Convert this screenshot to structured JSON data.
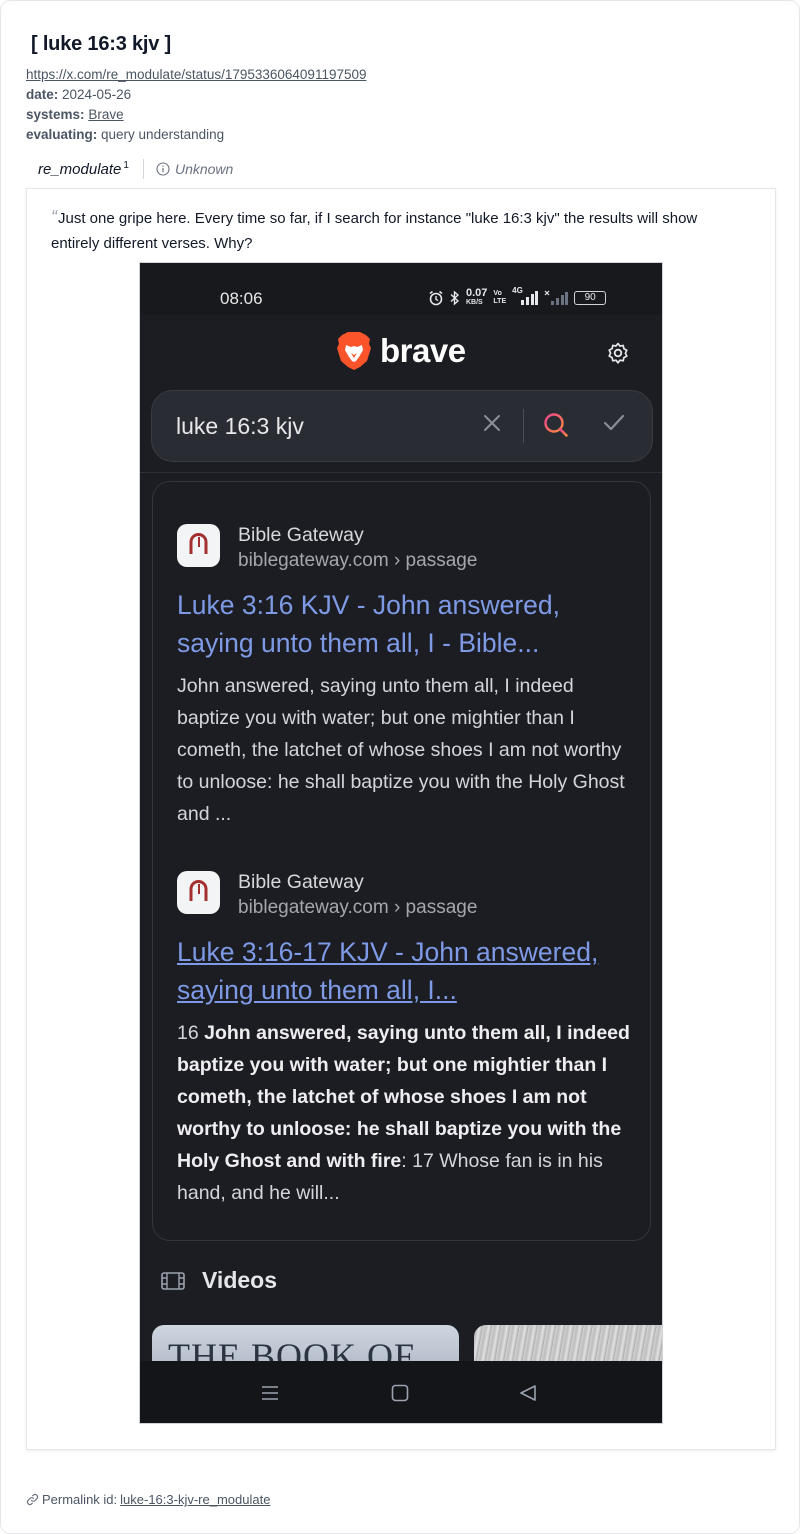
{
  "header": {
    "title": "[ luke 16:3 kjv ]",
    "source_url": "https://x.com/re_modulate/status/1795336064091197509",
    "date_label": "date:",
    "date_value": "2024-05-26",
    "systems_label": "systems:",
    "systems_value": "Brave",
    "evaluating_label": "evaluating:",
    "evaluating_value": "query understanding"
  },
  "tabs": {
    "author": "re_modulate",
    "author_sup": "1",
    "unknown": "Unknown"
  },
  "quote": {
    "mark": "“",
    "text": "Just one gripe here. Every time so far, if I search for instance \"luke 16:3 kjv\" the results will show entirely different verses. Why?"
  },
  "phone": {
    "status": {
      "time": "08:06",
      "speed_top": "0.07",
      "speed_bottom": "KB/S",
      "volte_top": "Vo",
      "volte_bottom": "LTE",
      "network": "4G",
      "battery": "90"
    },
    "brand": "brave",
    "search": {
      "query": "luke 16:3 kjv"
    },
    "results": [
      {
        "site_name": "Bible Gateway",
        "site_url": "biblegateway.com › passage",
        "title": "Luke 3:16 KJV - John answered, saying unto them all, I - Bible...",
        "description": "John answered, saying unto them all, I indeed baptize you with water; but one mightier than I cometh, the latchet of whose shoes I am not worthy to unloose: he shall baptize you with the Holy Ghost and ..."
      },
      {
        "site_name": "Bible Gateway",
        "site_url": "biblegateway.com › passage",
        "title": "Luke 3:16-17 KJV - John answered, saying unto them all, I...",
        "desc_prefix": "16 ",
        "desc_bold": "John answered, saying unto them all, I indeed baptize you with water; but one mightier than I cometh, the latchet of whose shoes I am not worthy to unloose: he shall baptize you with the Holy Ghost and with fire",
        "desc_suffix": ": 17 Whose fan is in his hand, and he will..."
      }
    ],
    "videos_label": "Videos",
    "video_thumb_text": "THE BOOK OF"
  },
  "footer": {
    "permalink_label": "Permalink id:",
    "permalink_id": "luke-16:3-kjv-re_modulate"
  },
  "colors": {
    "link_blue": "#7e9ae6",
    "brave_orange": "#fb542b",
    "search_icon_gradient": [
      "#f0458f",
      "#ff8a3d"
    ]
  }
}
